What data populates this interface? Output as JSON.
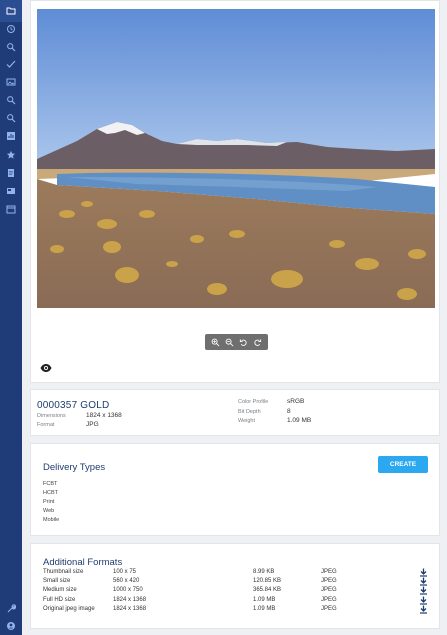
{
  "sidebar": {
    "icons": [
      "folder-icon",
      "history-icon",
      "search-icon",
      "check-icon",
      "image-icon",
      "search-icon",
      "search-icon",
      "chart-icon",
      "star-icon",
      "document-icon",
      "tag-icon",
      "calendar-icon"
    ],
    "bottom_icons": [
      "wrench-icon",
      "user-icon"
    ]
  },
  "viewer": {
    "toolbar": [
      "zoom-in-icon",
      "zoom-out-icon",
      "rotate-left-icon",
      "rotate-right-icon"
    ],
    "visibility_icon": "eye-icon"
  },
  "asset": {
    "title": "0000357 GOLD",
    "dimensions_label": "Dimensions",
    "dimensions_value": "1824 x 1368",
    "format_label": "Format",
    "format_value": "JPG",
    "color_profile_label": "Color Profile",
    "color_profile_value": "sRGB",
    "bit_depth_label": "Bit Depth",
    "bit_depth_value": "8",
    "weight_label": "Weight",
    "weight_value": "1.09 MB"
  },
  "delivery": {
    "title": "Delivery Types",
    "create_label": "CREATE",
    "types": [
      "FCBT",
      "HCBT",
      "Print",
      "Web",
      "Mobile"
    ]
  },
  "formats": {
    "title": "Additional Formats",
    "rows": [
      {
        "name": "Thumbnail size",
        "dims": "100 x 75",
        "size": "8.99 KB",
        "type": "JPEG"
      },
      {
        "name": "Small size",
        "dims": "560 x 420",
        "size": "120.85 KB",
        "type": "JPEG"
      },
      {
        "name": "Medium size",
        "dims": "1000 x 750",
        "size": "365.84 KB",
        "type": "JPEG"
      },
      {
        "name": "Full HD size",
        "dims": "1824 x 1368",
        "size": "1.09 MB",
        "type": "JPEG"
      },
      {
        "name": "Original jpeg image",
        "dims": "1824 x 1368",
        "size": "1.09 MB",
        "type": "JPEG"
      }
    ]
  },
  "colors": {
    "sidebar": "#1f3c78",
    "accent": "#2ba8ef",
    "title": "#1f3c6e"
  }
}
